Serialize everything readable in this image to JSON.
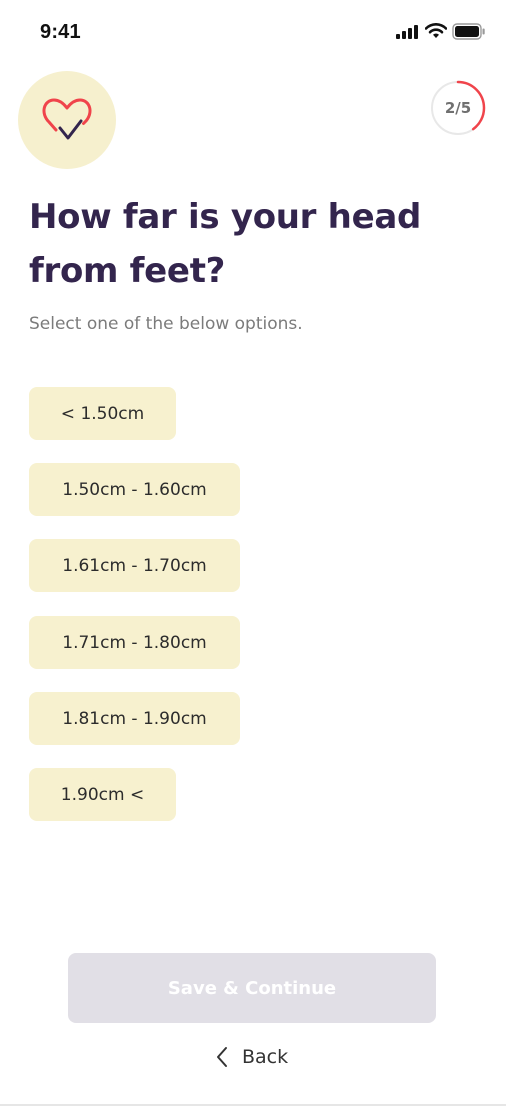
{
  "status_bar": {
    "time": "9:41",
    "icons": [
      "signal-icon",
      "wifi-icon",
      "battery-icon"
    ]
  },
  "header": {
    "logo_icon": "heart-check-icon",
    "progress": {
      "label": "2/5",
      "current": 2,
      "total": 5,
      "color": "#f0444b"
    }
  },
  "question": {
    "title": "How far is your head from feet?",
    "subtitle": "Select one of the below options."
  },
  "options": [
    "< 1.50cm",
    "1.50cm - 1.60cm",
    "1.61cm - 1.70cm",
    "1.71cm - 1.80cm",
    "1.81cm - 1.90cm",
    "1.90cm <"
  ],
  "footer": {
    "save_label": "Save & Continue",
    "save_enabled": false,
    "back_label": "Back",
    "back_icon": "chevron-left-icon"
  },
  "colors": {
    "title": "#33254d",
    "option_bg": "#f7f1cf",
    "badge_bg": "#f6f0ce",
    "accent": "#f0444b",
    "button_disabled": "#e1dfe6"
  }
}
